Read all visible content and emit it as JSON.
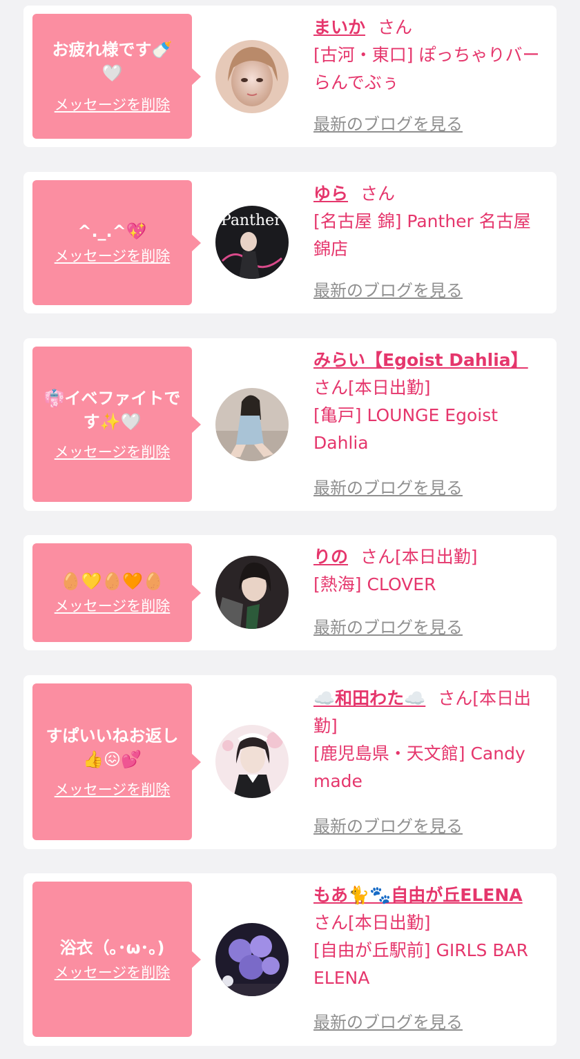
{
  "common": {
    "delete_label": "メッセージを削除",
    "blog_label": "最新のブログを見る",
    "san": "さん",
    "working_today": "[本日出勤]"
  },
  "colors": {
    "bubble": "#fb8ea1",
    "accent": "#e5366c",
    "link_gray": "#8f8f8f",
    "background": "#f2f2f4"
  },
  "items": [
    {
      "message": "お疲れ様です🍼🤍",
      "name": "まいか",
      "status": "",
      "shop": "[古河・東口] ぽっちゃりバー らんでぶぅ",
      "avatar_icon": "girl-portrait-avatar"
    },
    {
      "message": "^._.^💖",
      "name": "ゆら",
      "status": "",
      "shop": "[名古屋 錦] Panther 名古屋錦店",
      "avatar_icon": "girl-panther-logo-avatar"
    },
    {
      "message": "👘イベファイトです✨🤍",
      "name": "みらい【Egoist Dahlia】",
      "status": "[本日出勤]",
      "shop": "[亀戸] LOUNGE Egoist Dahlia",
      "avatar_icon": "girl-sitting-avatar"
    },
    {
      "message": "🥚💛🥚🧡🥚",
      "name": "りの",
      "status": "[本日出勤]",
      "shop": "[熱海] CLOVER",
      "avatar_icon": "girl-night-avatar"
    },
    {
      "message": "すぱいいねお返し👍😖💕",
      "name": "☁️和田わた☁️",
      "status": "[本日出勤]",
      "shop": "[鹿児島県・天文館] Candy made",
      "avatar_icon": "girl-maid-avatar"
    },
    {
      "message": "浴衣（｡･ω･｡)",
      "name": "もあ🐈🐾自由が丘ELENA",
      "status": "[本日出勤]",
      "shop": "[自由が丘駅前] GIRLS BAR ELENA",
      "avatar_icon": "balloons-avatar"
    }
  ]
}
